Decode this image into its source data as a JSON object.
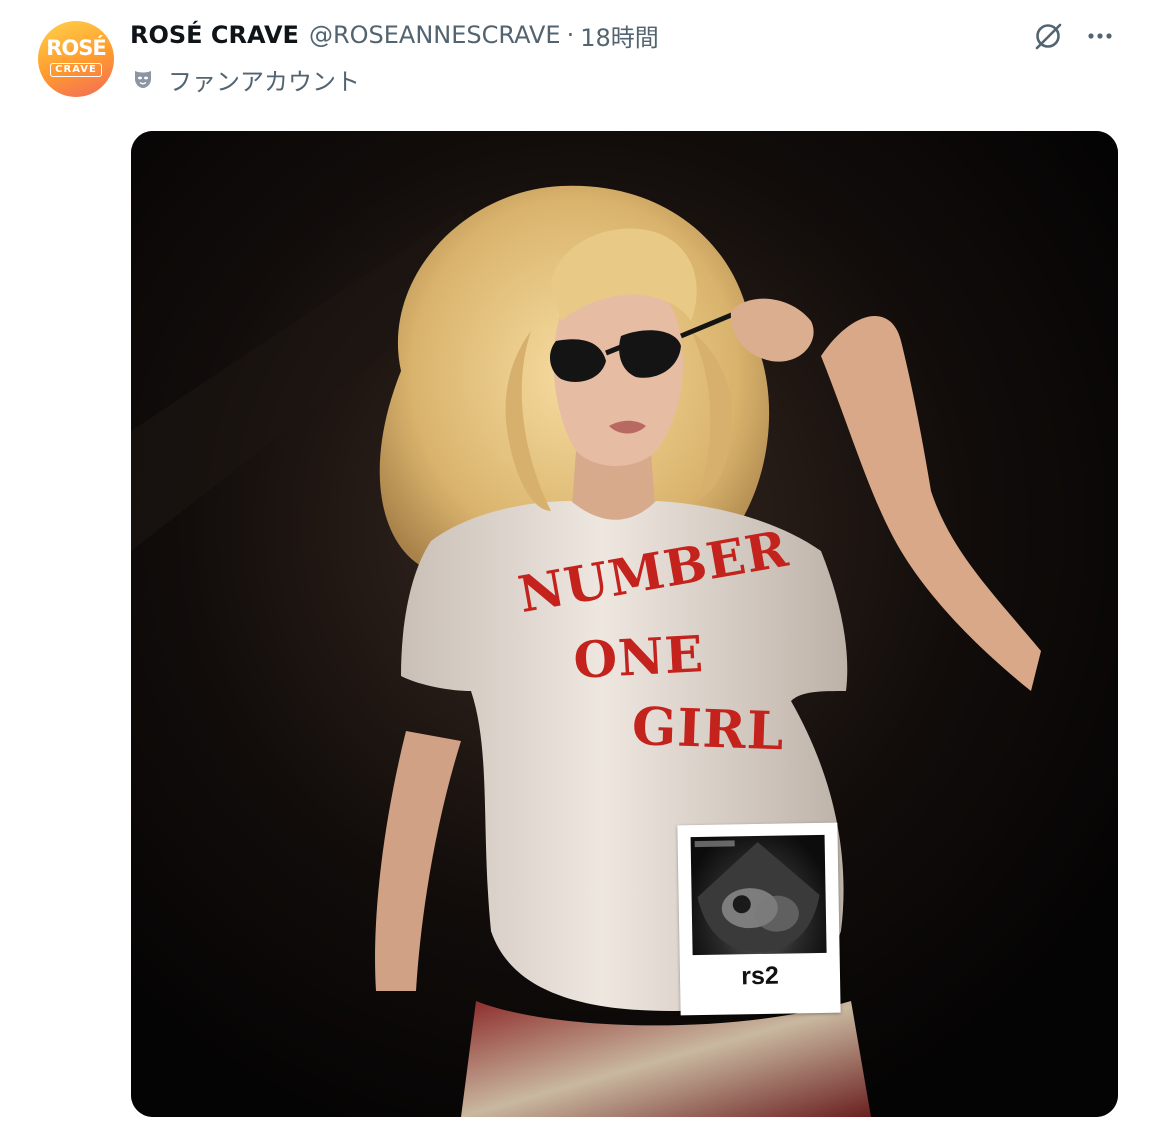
{
  "account": {
    "display_name": "ROSÉ CRAVE",
    "handle": "@ROSEANNESCRAVE",
    "separator": "·",
    "timestamp": "18時間",
    "affiliation_label": "ファンアカウント",
    "avatar_logo_line1": "ROSÉ",
    "avatar_logo_line2": "CRAVE"
  },
  "media": {
    "shirt_text_line1": "NUMBER",
    "shirt_text_line2": "ONE",
    "shirt_text_line3": "GIRL",
    "sticker_label": "rs2"
  },
  "icons": {
    "grok": "grok-icon",
    "more": "more-icon",
    "affiliation": "mask-icon"
  },
  "colors": {
    "name": "#0f1419",
    "secondary": "#536471",
    "shirt_print": "#c4221c",
    "avatar_gradient_top": "#ffd24a",
    "avatar_gradient_bottom": "#f26a5b"
  }
}
